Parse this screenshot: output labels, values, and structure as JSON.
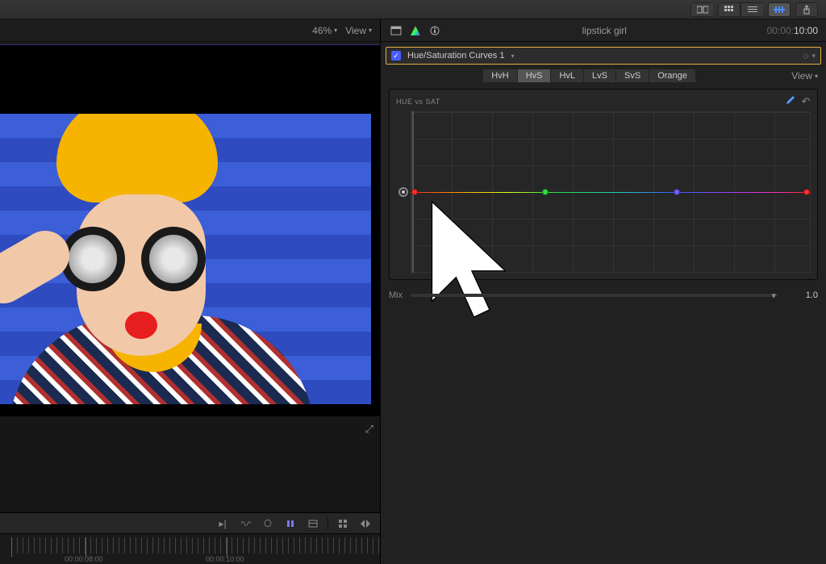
{
  "toolbar": {
    "share_tooltip": "Share"
  },
  "viewer": {
    "zoom_label": "46%",
    "view_label": "View"
  },
  "timeline": {
    "marks": [
      {
        "pos": 106,
        "label": "00:00:08:00"
      },
      {
        "pos": 281,
        "label": "00:00:10:00"
      }
    ]
  },
  "inspector": {
    "clip_title": "lipstick girl",
    "timecode_prefix": "00:00:",
    "timecode_main": "10:00",
    "effect": {
      "name": "Hue/Saturation Curves 1"
    },
    "tabs": [
      "HvH",
      "HvS",
      "HvL",
      "LvS",
      "SvS",
      "Orange"
    ],
    "active_tab": 1,
    "view_label": "View",
    "curve": {
      "title": "HUE vs SAT",
      "control_points": [
        {
          "x_pct": 1.0,
          "color": "#ff3030"
        },
        {
          "x_pct": 33.7,
          "color": "#30e040"
        },
        {
          "x_pct": 66.5,
          "color": "#7a5cff"
        },
        {
          "x_pct": 99.0,
          "color": "#ff3030"
        }
      ]
    },
    "mix": {
      "label": "Mix",
      "value": "1.0"
    }
  }
}
